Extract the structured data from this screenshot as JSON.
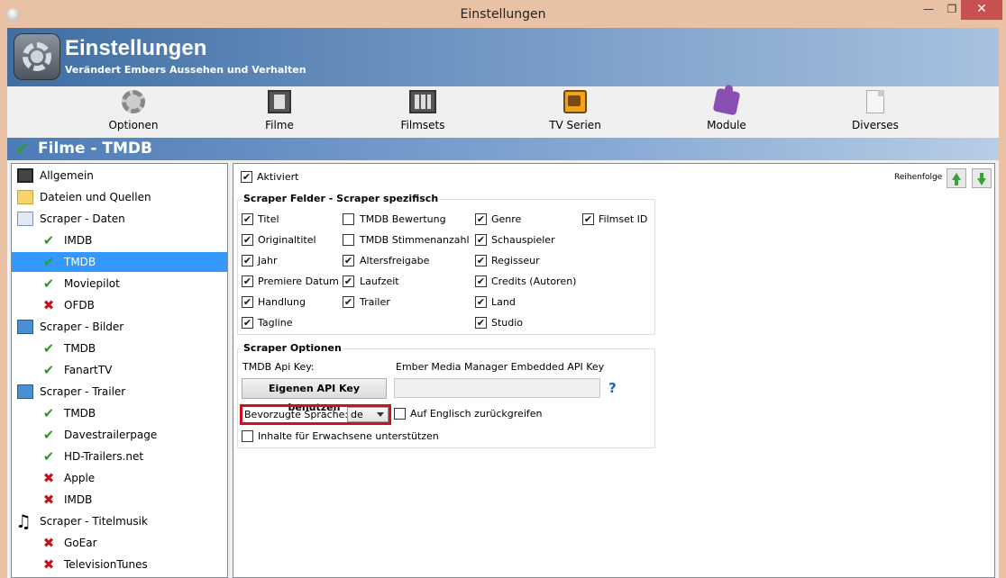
{
  "window": {
    "title": "Einstellungen",
    "close_glyph": "✕",
    "min_glyph": "—",
    "max_glyph": "❐"
  },
  "banner": {
    "title": "Einstellungen",
    "subtitle": "Verändert Embers Aussehen und Verhalten",
    "icon": "settings-gear-icon"
  },
  "toolbar": {
    "items": [
      {
        "label": "Optionen",
        "icon": "gear-icon"
      },
      {
        "label": "Filme",
        "icon": "film-icon"
      },
      {
        "label": "Filmsets",
        "icon": "filmsets-icon"
      },
      {
        "label": "TV Serien",
        "icon": "tv-icon"
      },
      {
        "label": "Module",
        "icon": "puzzle-icon"
      },
      {
        "label": "Diverses",
        "icon": "document-icon"
      }
    ]
  },
  "section": {
    "title": "Filme - TMDB",
    "check_glyph": "✔"
  },
  "tree": {
    "items": [
      {
        "label": "Allgemein",
        "icon": "film-icon",
        "level": 0
      },
      {
        "label": "Dateien und Quellen",
        "icon": "folder-icon",
        "level": 0
      },
      {
        "label": "Scraper - Daten",
        "icon": "scraper-icon",
        "level": 0
      },
      {
        "label": "IMDB",
        "icon": "check-icon",
        "level": 1
      },
      {
        "label": "TMDB",
        "icon": "check-icon",
        "level": 1,
        "selected": true
      },
      {
        "label": "Moviepilot",
        "icon": "check-icon",
        "level": 1
      },
      {
        "label": "OFDB",
        "icon": "x-icon",
        "level": 1
      },
      {
        "label": "Scraper - Bilder",
        "icon": "image-icon",
        "level": 0
      },
      {
        "label": "TMDB",
        "icon": "check-icon",
        "level": 1
      },
      {
        "label": "FanartTV",
        "icon": "check-icon",
        "level": 1
      },
      {
        "label": "Scraper - Trailer",
        "icon": "image-icon",
        "level": 0
      },
      {
        "label": "TMDB",
        "icon": "check-icon",
        "level": 1
      },
      {
        "label": "Davestrailerpage",
        "icon": "check-icon",
        "level": 1
      },
      {
        "label": "HD-Trailers.net",
        "icon": "check-icon",
        "level": 1
      },
      {
        "label": "Apple",
        "icon": "x-icon",
        "level": 1
      },
      {
        "label": "IMDB",
        "icon": "x-icon",
        "level": 1
      },
      {
        "label": "Scraper - Titelmusik",
        "icon": "music-icon",
        "level": 0
      },
      {
        "label": "GoEar",
        "icon": "x-icon",
        "level": 1
      },
      {
        "label": "TelevisionTunes",
        "icon": "x-icon",
        "level": 1
      }
    ]
  },
  "panel": {
    "activated": {
      "label": "Aktiviert",
      "checked": true
    },
    "order_label": "Reihenfolge",
    "fields_group": {
      "title": "Scraper Felder - Scraper spezifisch",
      "fields": [
        {
          "label": "Titel",
          "checked": true
        },
        {
          "label": "Originaltitel",
          "checked": true
        },
        {
          "label": "Jahr",
          "checked": true
        },
        {
          "label": "Premiere Datum",
          "checked": true
        },
        {
          "label": "Handlung",
          "checked": true
        },
        {
          "label": "Tagline",
          "checked": true
        },
        {
          "label": "TMDB Bewertung",
          "checked": false
        },
        {
          "label": "TMDB Stimmenanzahl",
          "checked": false
        },
        {
          "label": "Altersfreigabe",
          "checked": true
        },
        {
          "label": "Laufzeit",
          "checked": true
        },
        {
          "label": "Trailer",
          "checked": true
        },
        {
          "label": "Genre",
          "checked": true
        },
        {
          "label": "Schauspieler",
          "checked": true
        },
        {
          "label": "Regisseur",
          "checked": true
        },
        {
          "label": "Credits (Autoren)",
          "checked": true
        },
        {
          "label": "Land",
          "checked": true
        },
        {
          "label": "Studio",
          "checked": true
        },
        {
          "label": "Filmset ID",
          "checked": true
        }
      ]
    },
    "options_group": {
      "title": "Scraper Optionen",
      "api_key_label": "TMDB Api Key:",
      "api_key_value": "Ember Media Manager Embedded API Key",
      "own_key_button": "Eigenen API Key benutzen",
      "api_key_input": "",
      "help_glyph": "?",
      "language_label": "Bevorzugte Sprache:",
      "language_value": "de",
      "fallback_label": "Auf Englisch zurückgreifen",
      "fallback_checked": false,
      "adult_label": "Inhalte für Erwachsene unterstützen",
      "adult_checked": false
    }
  }
}
